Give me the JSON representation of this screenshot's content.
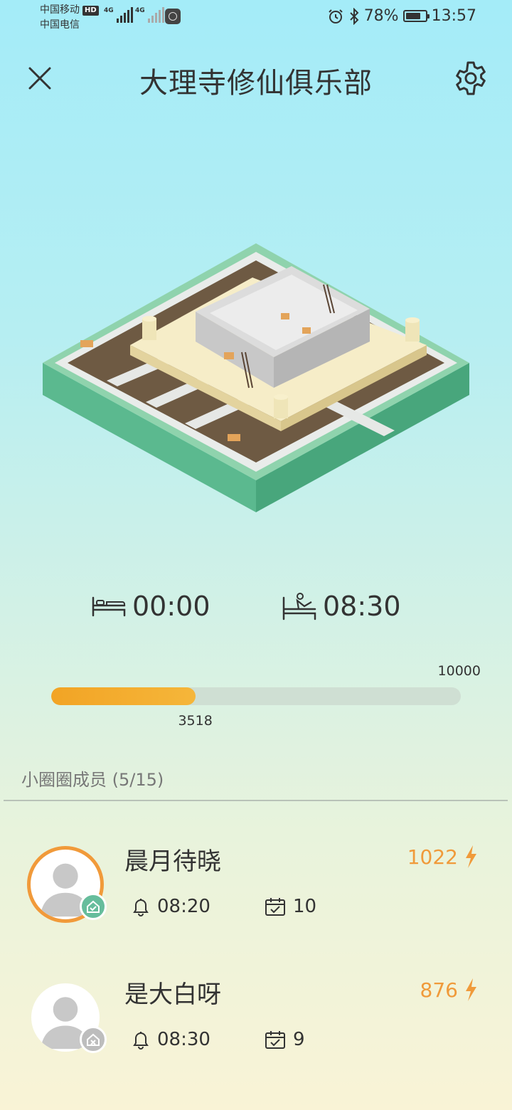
{
  "status_bar": {
    "carrier1": "中国移动",
    "carrier1_badge": "HD",
    "carrier2": "中国电信",
    "network1": "4G",
    "network2": "4G",
    "battery_percent": "78%",
    "battery_level": 0.78,
    "time": "13:57"
  },
  "header": {
    "title": "大理寺修仙俱乐部",
    "close_icon": "close-icon",
    "settings_icon": "gear-icon"
  },
  "schedule": {
    "sleep_icon": "bed-icon",
    "sleep_time": "00:00",
    "wake_icon": "wake-up-icon",
    "wake_time": "08:30"
  },
  "progress": {
    "goal_label": "10000",
    "current_label": "3518",
    "goal": 10000,
    "current": 3518,
    "fill_color": "#f2a425"
  },
  "members": {
    "title": "小圈圈成员 (5/15)",
    "items": [
      {
        "name": "晨月待晓",
        "score": "1022",
        "alarm": "08:20",
        "days": "10",
        "status": "checked-in",
        "ring_color": "#f19a3a"
      },
      {
        "name": "是大白呀",
        "score": "876",
        "alarm": "08:30",
        "days": "9",
        "status": "not-checked-in"
      }
    ]
  },
  "colors": {
    "accent": "#f09a3a",
    "badge_ok": "#66bd9c",
    "badge_off": "#bdbdbd"
  }
}
